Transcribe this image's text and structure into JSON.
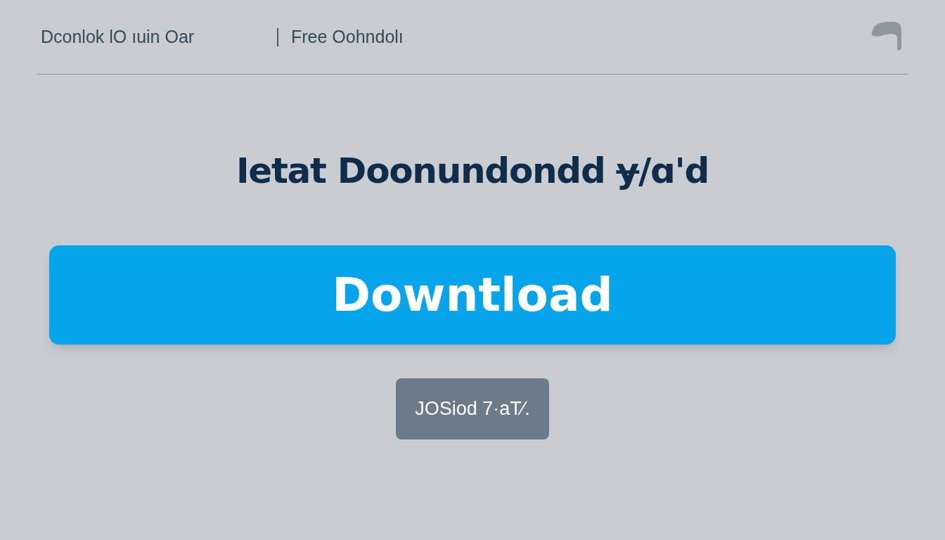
{
  "header": {
    "title": "Dconlok lO ıuin Oar",
    "subtitle": "Free Oohndolı"
  },
  "heading": "Ietat Doonundondd ɏ/ɑ'd",
  "download_button": {
    "label": "Downtload"
  },
  "secondary_button": {
    "label": "JOSiod 7·aT⁄."
  }
}
